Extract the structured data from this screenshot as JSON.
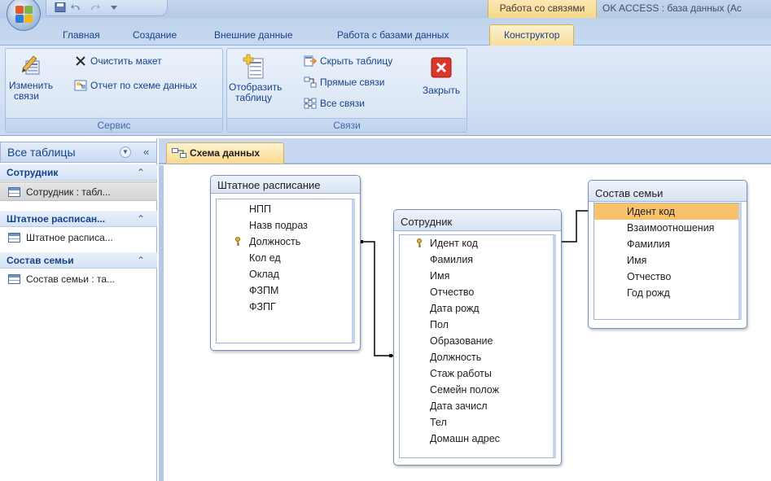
{
  "title_bar": {
    "context_tab_title": "Работа со связями",
    "app_title": "OK ACCESS : база данных (Ac"
  },
  "ribbon_tabs": [
    "Главная",
    "Создание",
    "Внешние данные",
    "Работа с базами данных",
    "Конструктор"
  ],
  "active_tab": "Конструктор",
  "ribbon": {
    "service_group": {
      "label": "Сервис",
      "edit_relations": [
        "Изменить",
        "связи"
      ],
      "clear_layout": "Очистить макет",
      "schema_report": "Отчет по схеме данных"
    },
    "relations_group": {
      "label": "Связи",
      "show_table": [
        "Отобразить",
        "таблицу"
      ],
      "hide_table": "Скрыть таблицу",
      "direct_relations": "Прямые связи",
      "all_relations": "Все связи",
      "close": "Закрыть"
    }
  },
  "nav_pane": {
    "header": "Все таблицы",
    "groups": [
      {
        "title": "Сотрудник",
        "item": "Сотрудник : табл..."
      },
      {
        "title": "Штатное расписан...",
        "item": "Штатное расписа..."
      },
      {
        "title": "Состав семьи",
        "item": "Состав семьи : та..."
      }
    ]
  },
  "document_tab": "Схема данных",
  "tables": {
    "staffing": {
      "title": "Штатное расписание",
      "fields": [
        "НПП",
        "Назв подраз",
        "Должность",
        "Кол ед",
        "Оклад",
        "ФЗПМ",
        "ФЗПГ"
      ],
      "key_field": "Должность"
    },
    "employee": {
      "title": "Сотрудник",
      "fields": [
        "Идент код",
        "Фамилия",
        "Имя",
        "Отчество",
        "Дата рожд",
        "Пол",
        "Образование",
        "Должность",
        "Стаж работы",
        "Семейн полож",
        "Дата зачисл",
        "Тел",
        "Домашн адрес"
      ],
      "key_field": "Идент код"
    },
    "family": {
      "title": "Состав семьи",
      "fields": [
        "Идент код",
        "Взаимоотношения",
        "Фамилия",
        "Имя",
        "Отчество",
        "Год рожд"
      ],
      "selected_field": "Идент код"
    }
  },
  "colors": {
    "ribbon_blue": "#d3e1f3",
    "active_tab_gold": "#f8dd9c",
    "highlight_orange": "#f8c26d",
    "close_red": "#d9362c",
    "relation_line": "#000000"
  },
  "icons": [
    "office-button-icon",
    "edit-relations-icon",
    "clear-layout-icon",
    "report-icon",
    "show-table-icon",
    "hide-table-icon",
    "direct-relations-icon",
    "all-relations-icon",
    "close-icon",
    "table-icon",
    "key-icon",
    "relationships-tab-icon"
  ]
}
